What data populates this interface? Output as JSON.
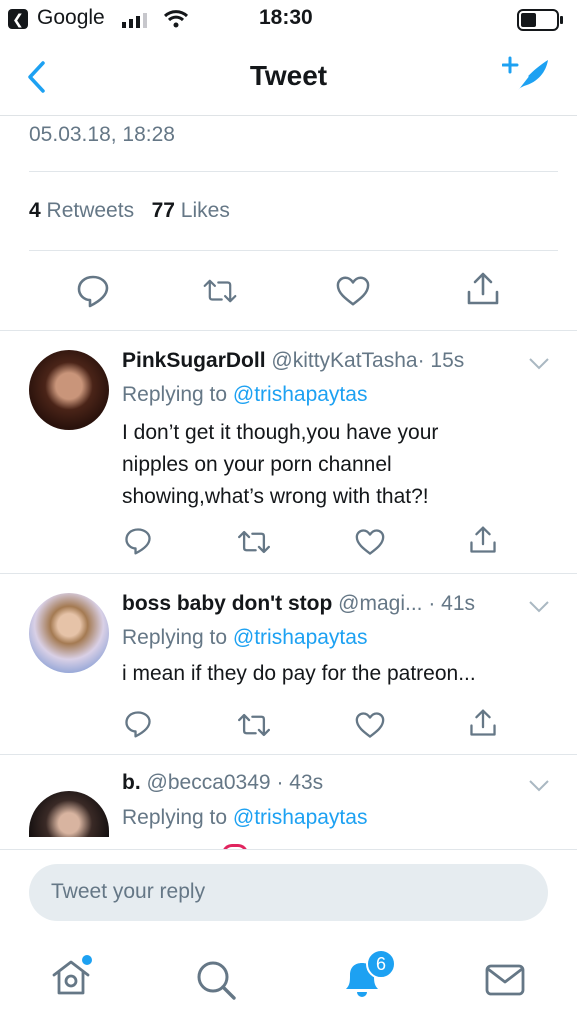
{
  "status_bar": {
    "back_app": "Google",
    "time": "18:30"
  },
  "nav": {
    "title": "Tweet"
  },
  "tweet": {
    "timestamp": "05.03.18, 18:28",
    "retweets_count": "4",
    "retweets_label": "Retweets",
    "likes_count": "77",
    "likes_label": "Likes"
  },
  "replies": [
    {
      "display_name": "PinkSugarDoll",
      "handle": "@kittyKatTasha",
      "time": "· 15s",
      "replying_prefix": "Replying to",
      "replying_to": "@trishapaytas",
      "text_lines": [
        "I don’t get it though,you have your",
        "nipples on your porn channel",
        "showing,what’s wrong with that?!"
      ]
    },
    {
      "display_name": "boss baby don't stop",
      "handle": "@magi...",
      "time": "· 41s",
      "replying_prefix": "Replying to",
      "replying_to": "@trishapaytas",
      "text_lines": [
        "i mean if they do pay for the patreon..."
      ]
    },
    {
      "display_name": "b.",
      "handle": "@becca0349",
      "time": "· 43s",
      "replying_prefix": "Replying to",
      "replying_to": "@trishapaytas",
      "text_lines": []
    }
  ],
  "composer": {
    "placeholder": "Tweet your reply"
  },
  "tabbar": {
    "notifications_badge": "6"
  },
  "colors": {
    "accent": "#1da1f2",
    "secondary_text": "#657786",
    "divider": "#e1e6ea"
  }
}
